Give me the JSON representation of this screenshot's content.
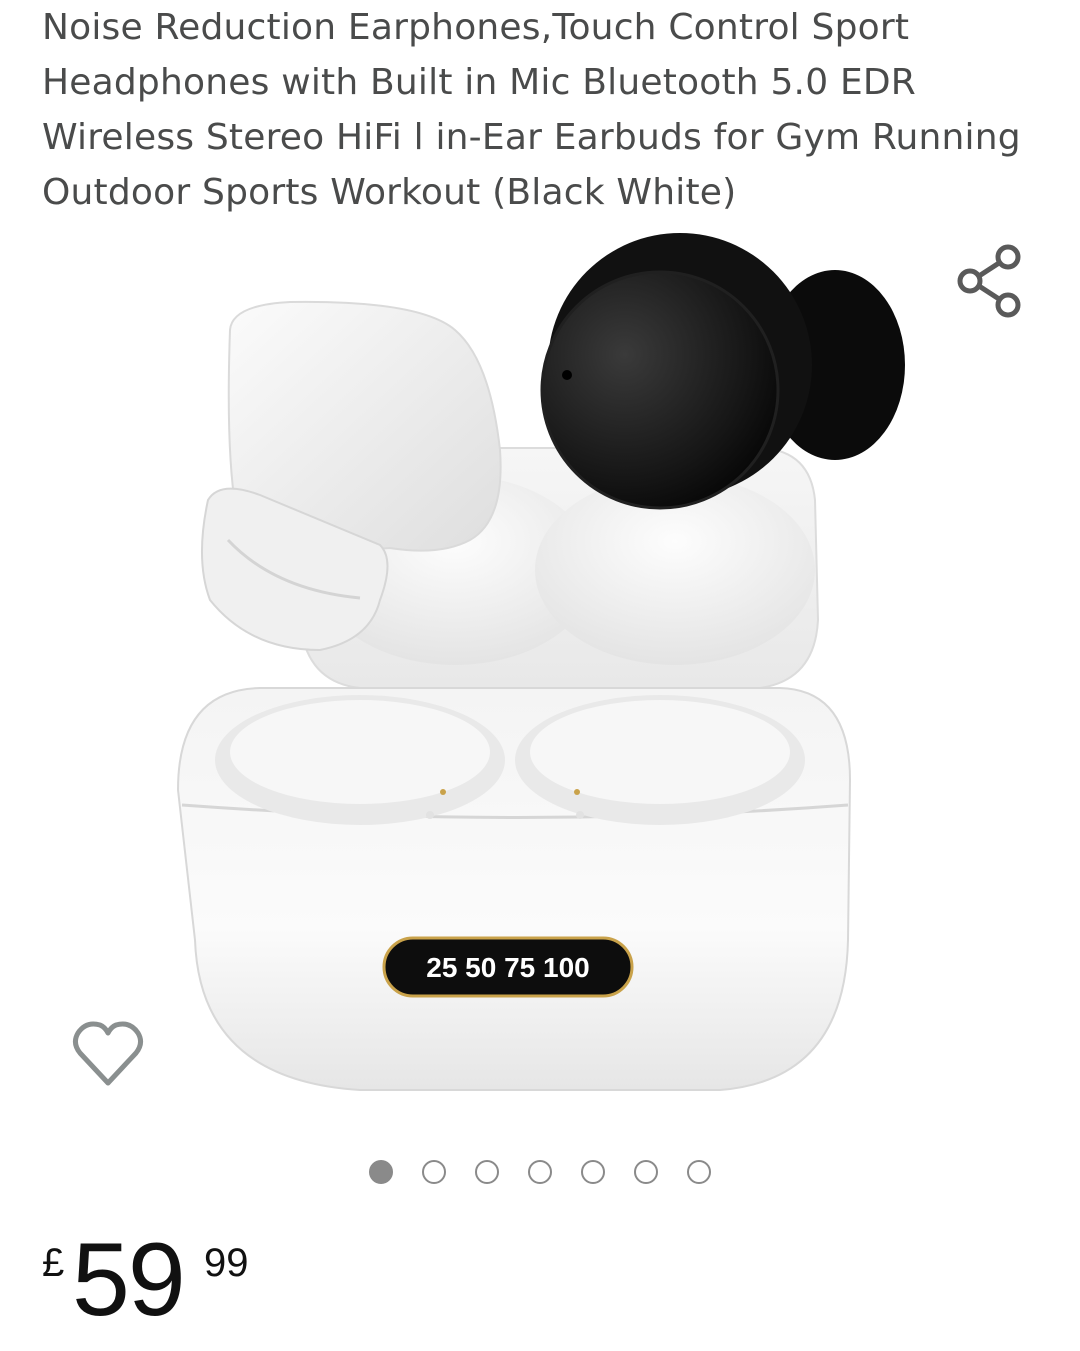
{
  "product": {
    "title": "Noise Reduction Earphones,Touch Control Sport Headphones with Built in Mic Bluetooth 5.0 EDR Wireless Stereo HiFi l in-Ear Earbuds for Gym Running Outdoor Sports Workout (Black White)",
    "image": {
      "case_display_text": "25 50 75 100"
    }
  },
  "actions": {
    "share_icon": "share-icon",
    "wishlist_icon": "heart-outline-icon"
  },
  "gallery": {
    "image_count": 7,
    "active_index": 0
  },
  "price": {
    "currency": "£",
    "whole": "59",
    "fraction": "99"
  },
  "colors": {
    "text": "#4a4b4b",
    "price": "#111111",
    "dot": "#8a8a8a",
    "display_gold": "#c9a24a"
  }
}
